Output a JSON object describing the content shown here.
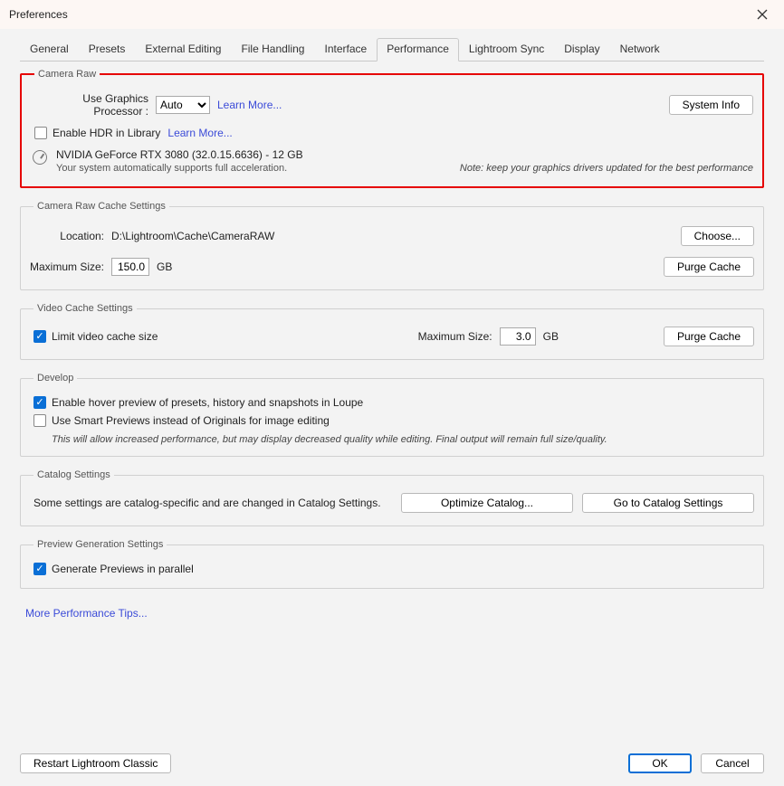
{
  "window": {
    "title": "Preferences"
  },
  "tabs": [
    "General",
    "Presets",
    "External Editing",
    "File Handling",
    "Interface",
    "Performance",
    "Lightroom Sync",
    "Display",
    "Network"
  ],
  "active_tab": "Performance",
  "camera_raw": {
    "legend": "Camera Raw",
    "gpu_label": "Use Graphics Processor :",
    "gpu_value": "Auto",
    "learn_more": "Learn More...",
    "system_info": "System Info",
    "hdr_checked": false,
    "hdr_label": "Enable HDR in Library",
    "hdr_learn_more": "Learn More...",
    "gpu_name": "NVIDIA GeForce RTX 3080 (32.0.15.6636) - 12 GB",
    "gpu_status": "Your system automatically supports full acceleration.",
    "driver_note": "Note: keep your graphics drivers updated for the best performance"
  },
  "cache": {
    "legend": "Camera Raw Cache Settings",
    "location_label": "Location:",
    "location_value": "D:\\Lightroom\\Cache\\CameraRAW",
    "choose": "Choose...",
    "max_label": "Maximum Size:",
    "max_value": "150.0",
    "unit": "GB",
    "purge": "Purge Cache"
  },
  "video": {
    "legend": "Video Cache Settings",
    "limit_checked": true,
    "limit_label": "Limit video cache size",
    "max_label": "Maximum Size:",
    "max_value": "3.0",
    "unit": "GB",
    "purge": "Purge Cache"
  },
  "develop": {
    "legend": "Develop",
    "hover_checked": true,
    "hover_label": "Enable hover preview of presets, history and snapshots in Loupe",
    "smart_checked": false,
    "smart_label": "Use Smart Previews instead of Originals for image editing",
    "note": "This will allow increased performance, but may display decreased quality while editing. Final output will remain full size/quality."
  },
  "catalog": {
    "legend": "Catalog Settings",
    "text": "Some settings are catalog-specific and are changed in Catalog Settings.",
    "optimize": "Optimize Catalog...",
    "goto": "Go to Catalog Settings"
  },
  "preview": {
    "legend": "Preview Generation Settings",
    "parallel_checked": true,
    "parallel_label": "Generate Previews in parallel"
  },
  "more_tips": "More Performance Tips...",
  "footer": {
    "restart": "Restart Lightroom Classic",
    "ok": "OK",
    "cancel": "Cancel"
  }
}
